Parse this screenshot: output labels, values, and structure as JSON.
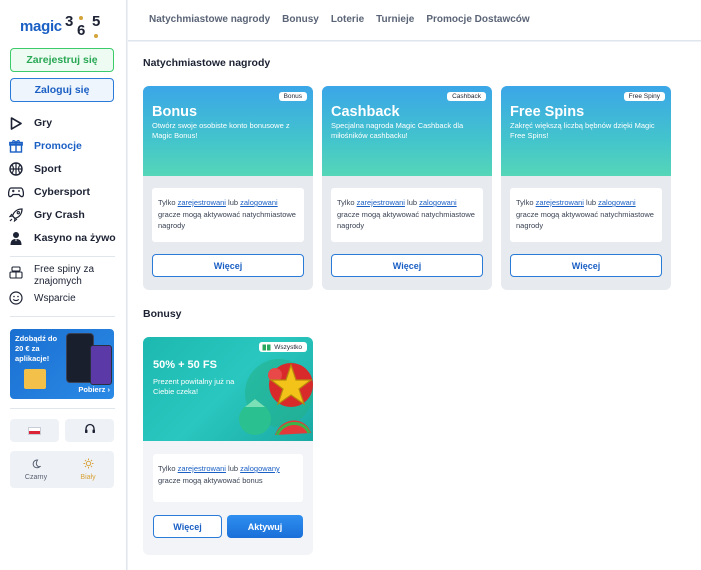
{
  "brand": {
    "logo_word": "magic",
    "logo_digits": [
      "3",
      "6",
      "5"
    ]
  },
  "auth": {
    "register_label": "Zarejestruj się",
    "login_label": "Zaloguj się"
  },
  "sidebar": {
    "items": [
      {
        "label": "Gry",
        "icon": "play-icon"
      },
      {
        "label": "Promocje",
        "icon": "gift-icon",
        "active": true
      },
      {
        "label": "Sport",
        "icon": "basketball-icon"
      },
      {
        "label": "Cybersport",
        "icon": "gamepad-icon"
      },
      {
        "label": "Gry Crash",
        "icon": "rocket-icon"
      },
      {
        "label": "Kasyno na żywo",
        "icon": "dealer-icon"
      }
    ],
    "extra_items": [
      {
        "label": "Free spiny za znajomych",
        "icon": "referral-icon"
      },
      {
        "label": "Wsparcie",
        "icon": "smile-icon"
      }
    ],
    "app_banner": {
      "text": "Zdobądź do 20 € za aplikacje!",
      "cta": "Pobierz"
    },
    "theme": {
      "dark_label": "Czarny",
      "light_label": "Biały",
      "active": "light"
    }
  },
  "topnav": {
    "tabs": [
      "Natychmiastowe nagrody",
      "Bonusy",
      "Loterie",
      "Turnieje",
      "Promocje Dostawców"
    ]
  },
  "main": {
    "instant_title": "Natychmiastowe nagrody",
    "bonuses_title": "Bonusy",
    "cards": [
      {
        "title": "Bonus",
        "badge": "Bonus",
        "desc": "Otwórz swoje osobiste konto bonusowe z Magic Bonus!"
      },
      {
        "title": "Cashback",
        "badge": "Cashback",
        "desc": "Specjalna nagroda Magic Cashback dla miłośników cashbacku!"
      },
      {
        "title": "Free Spins",
        "badge": "Free Spiny",
        "desc": "Zakręć większą liczbą bębnów dzięki Magic Free Spins!"
      }
    ],
    "card_info": {
      "prefix": "Tylko ",
      "registered": "zarejestrowani",
      "or": " lub ",
      "logged": "zalogowani",
      "suffix": " gracze mogą aktywować natychmiastowe nagrody"
    },
    "more_label": "Więcej",
    "bonus": {
      "title": "50% + 50 FS",
      "badge": "Wszystko",
      "desc": "Prezent powitalny już na Ciebie czeka!",
      "info_prefix": "Tylko ",
      "registered": "zarejestrowani",
      "or": " lub ",
      "logged": "zalogowany",
      "info_suffix": " gracze mogą aktywować bonus",
      "more_label": "Więcej",
      "activate_label": "Aktywuj"
    }
  },
  "colors": {
    "accent": "#1a5fc4",
    "success": "#29a855",
    "gold": "#d8a33a"
  }
}
